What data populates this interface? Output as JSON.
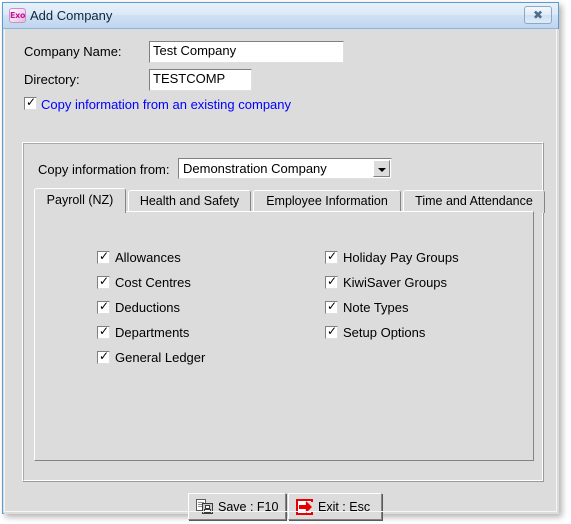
{
  "window": {
    "title": "Add Company",
    "app_icon": "exo-app-icon",
    "app_icon_text": "Exo",
    "close_button": "✖",
    "border_color": "#5c9ccc",
    "face_color": "#dcdcdc"
  },
  "form": {
    "company_name": {
      "label": "Company Name:",
      "value": "Test Company",
      "placeholder": ""
    },
    "directory": {
      "label": "Directory:",
      "value": "TESTCOMP",
      "placeholder": ""
    },
    "copy_existing": {
      "label": "Copy information from an existing company",
      "checked": true,
      "link_color": "#0000ff"
    }
  },
  "groupbox": {
    "copy_from": {
      "label": "Copy information from:",
      "value": "Demonstration Company",
      "options": [
        "Demonstration Company"
      ]
    },
    "tabs": [
      {
        "label": "Payroll (NZ)",
        "active": true
      },
      {
        "label": "Health and Safety",
        "active": false
      },
      {
        "label": "Employee Information",
        "active": false
      },
      {
        "label": "Time and Attendance",
        "active": false
      }
    ],
    "checkbox_columns": [
      {
        "items": [
          {
            "label": "Allowances",
            "checked": true
          },
          {
            "label": "Cost Centres",
            "checked": true
          },
          {
            "label": "Deductions",
            "checked": true
          },
          {
            "label": "Departments",
            "checked": true
          },
          {
            "label": "General Ledger",
            "checked": true
          }
        ]
      },
      {
        "items": [
          {
            "label": "Holiday Pay Groups",
            "checked": true
          },
          {
            "label": "KiwiSaver Groups",
            "checked": true
          },
          {
            "label": "Note Types",
            "checked": true
          },
          {
            "label": "Setup Options",
            "checked": true
          }
        ]
      }
    ]
  },
  "buttons": {
    "save": {
      "label": "Save : F10",
      "icon": "save-icon"
    },
    "exit": {
      "label": "Exit : Esc",
      "icon": "exit-door-icon",
      "icon_color": "#e80000"
    }
  }
}
